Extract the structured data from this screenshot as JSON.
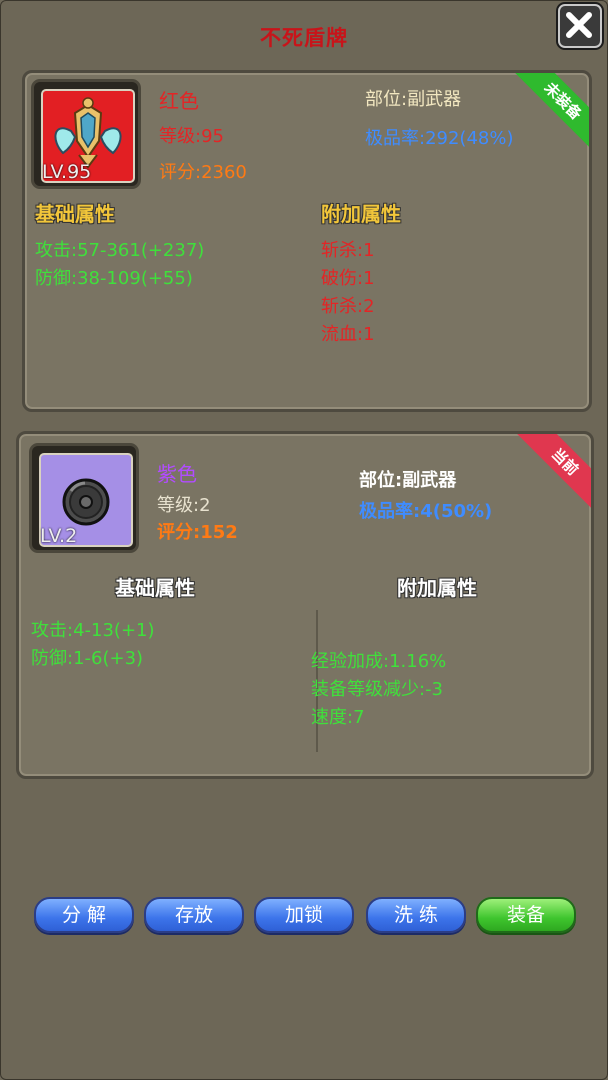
{
  "title": "不死盾牌",
  "item_new": {
    "level_badge": "LV.95",
    "quality": "红色",
    "level": "等级:95",
    "score": "评分:2360",
    "slot": "部位:副武器",
    "rate": "极品率:292(48%)",
    "status": "未装备",
    "base_header": "基础属性",
    "extra_header": "附加属性",
    "base_attrs": [
      "攻击:57-361(+237)",
      "防御:38-109(+55)"
    ],
    "extra_attrs": [
      "斩杀:1",
      "破伤:1",
      "斩杀:2",
      "流血:1"
    ]
  },
  "item_current": {
    "level_badge": "LV.2",
    "quality": "紫色",
    "level": "等级:2",
    "score": "评分:152",
    "slot": "部位:副武器",
    "rate": "极品率:4(50%)",
    "status": "当前",
    "base_header": "基础属性",
    "extra_header": "附加属性",
    "base_attrs": [
      "攻击:4-13(+1)",
      "防御:1-6(+3)"
    ],
    "extra_attrs": [
      "经验加成:1.16%",
      "装备等级减少:-3",
      "速度:7"
    ]
  },
  "buttons": {
    "decompose": "分 解",
    "store": "存放",
    "lock": "加锁",
    "refine": "洗 练",
    "equip": "装备"
  }
}
